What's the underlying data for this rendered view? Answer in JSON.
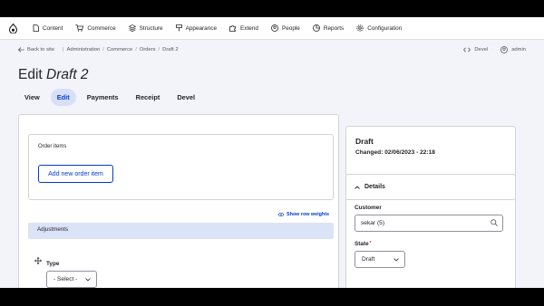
{
  "toolbar": {
    "items": [
      {
        "label": "Content",
        "icon": "content-icon"
      },
      {
        "label": "Commerce",
        "icon": "cart-icon"
      },
      {
        "label": "Structure",
        "icon": "structure-icon"
      },
      {
        "label": "Appearance",
        "icon": "brush-icon"
      },
      {
        "label": "Extend",
        "icon": "puzzle-icon"
      },
      {
        "label": "People",
        "icon": "person-icon"
      },
      {
        "label": "Reports",
        "icon": "chart-icon"
      },
      {
        "label": "Configuration",
        "icon": "gear-icon"
      }
    ]
  },
  "breadcrumb": {
    "back": "Back to site",
    "items": [
      "Administration",
      "Commerce",
      "Orders",
      "Draft 2"
    ]
  },
  "secondary": {
    "devel": "Devel",
    "user": "admin"
  },
  "page": {
    "title_prefix": "Edit",
    "title_italic": "Draft 2"
  },
  "tabs": [
    {
      "label": "View",
      "active": false
    },
    {
      "label": "Edit",
      "active": true
    },
    {
      "label": "Payments",
      "active": false
    },
    {
      "label": "Receipt",
      "active": false
    },
    {
      "label": "Devel",
      "active": false
    }
  ],
  "order_items": {
    "label": "Order items",
    "add_button": "Add new order item"
  },
  "show_row_weights": "Show row weights",
  "adjustments": {
    "label": "Adjustments",
    "type_label": "Type",
    "type_value": "- Select -"
  },
  "status": {
    "title": "Draft",
    "changed": "Changed: 02/06/2023 - 22:18"
  },
  "details": {
    "heading": "Details",
    "customer_label": "Customer",
    "customer_value": "sekar (5)",
    "state_label": "State",
    "state_required": "*",
    "state_value": "Draft"
  },
  "colors": {
    "accent": "#003ecc",
    "tab_active_bg": "#d8dff9",
    "page_bg": "#f3f4f9",
    "required": "#dc2323"
  }
}
